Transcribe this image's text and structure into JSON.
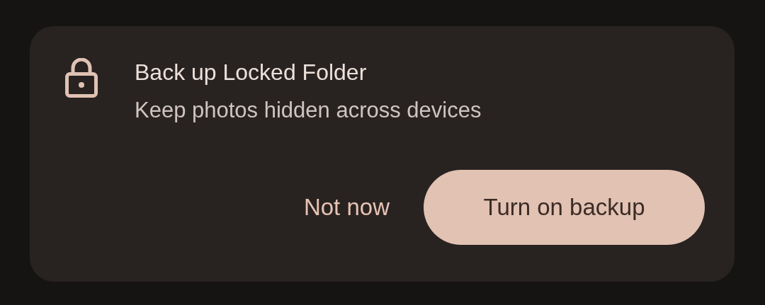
{
  "card": {
    "title": "Back up Locked Folder",
    "subtitle": "Keep photos hidden across devices",
    "buttons": [
      {
        "kind": "text",
        "label": "Not now"
      },
      {
        "kind": "filled",
        "label": "Turn on backup"
      }
    ]
  }
}
